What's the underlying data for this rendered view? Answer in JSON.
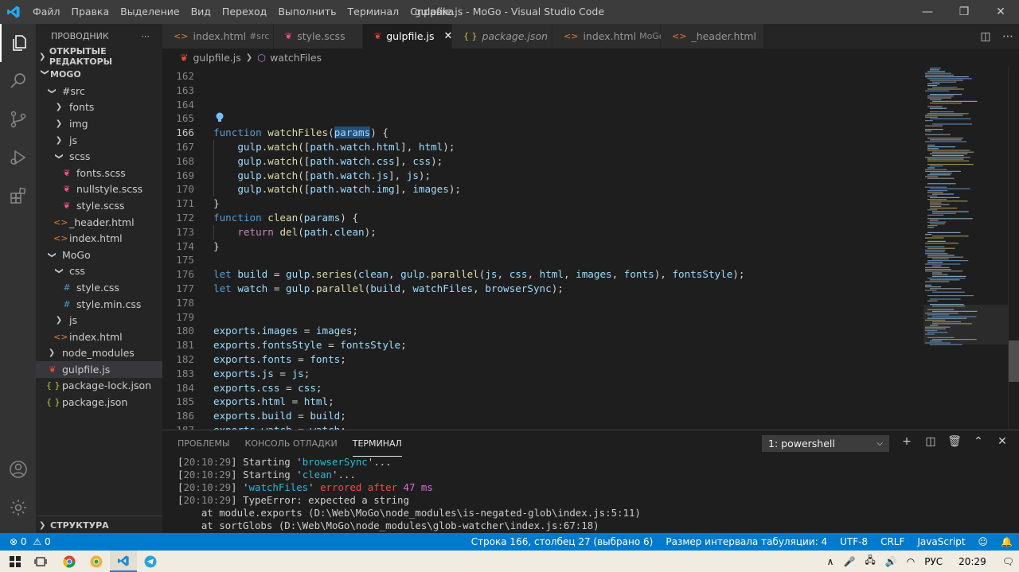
{
  "titlebar": {
    "menu": [
      "Файл",
      "Правка",
      "Выделение",
      "Вид",
      "Переход",
      "Выполнить",
      "Терминал",
      "Справка"
    ],
    "title": "gulpfile.js - MoGo - Visual Studio Code"
  },
  "sidebar": {
    "header": "ПРОВОДНИК",
    "open_editors": "ОТКРЫТЫЕ РЕДАКТОРЫ",
    "project": "MOGO",
    "items": [
      {
        "label": "#src",
        "kind": "folder-open",
        "depth": 1
      },
      {
        "label": "fonts",
        "kind": "folder",
        "depth": 2
      },
      {
        "label": "img",
        "kind": "folder",
        "depth": 2
      },
      {
        "label": "js",
        "kind": "folder",
        "depth": 2
      },
      {
        "label": "scss",
        "kind": "folder-open",
        "depth": 2
      },
      {
        "label": "fonts.scss",
        "kind": "scss",
        "depth": 3
      },
      {
        "label": "nullstyle.scss",
        "kind": "scss",
        "depth": 3
      },
      {
        "label": "style.scss",
        "kind": "scss",
        "depth": 3
      },
      {
        "label": "_header.html",
        "kind": "html",
        "depth": 2
      },
      {
        "label": "index.html",
        "kind": "html",
        "depth": 2
      },
      {
        "label": "MoGo",
        "kind": "folder-open",
        "depth": 1
      },
      {
        "label": "css",
        "kind": "folder-open",
        "depth": 2
      },
      {
        "label": "style.css",
        "kind": "css",
        "depth": 3
      },
      {
        "label": "style.min.css",
        "kind": "css",
        "depth": 3
      },
      {
        "label": "js",
        "kind": "folder",
        "depth": 2
      },
      {
        "label": "index.html",
        "kind": "html",
        "depth": 2
      },
      {
        "label": "node_modules",
        "kind": "folder",
        "depth": 1
      },
      {
        "label": "gulpfile.js",
        "kind": "gulp",
        "depth": 1,
        "selected": true
      },
      {
        "label": "package-lock.json",
        "kind": "json",
        "depth": 1
      },
      {
        "label": "package.json",
        "kind": "json",
        "depth": 1
      }
    ],
    "outline": "СТРУКТУРА"
  },
  "tabs": [
    {
      "label": "index.html",
      "desc": "#src",
      "kind": "html",
      "width": 140
    },
    {
      "label": "style.scss",
      "desc": "",
      "kind": "scss",
      "width": 112
    },
    {
      "label": "gulpfile.js",
      "desc": "",
      "kind": "gulp",
      "active": true,
      "width": 112
    },
    {
      "label": "package.json",
      "desc": "",
      "kind": "json",
      "italic": true,
      "width": 126
    },
    {
      "label": "index.html",
      "desc": "MoGo",
      "kind": "html",
      "width": 136
    },
    {
      "label": "_header.html",
      "desc": "",
      "kind": "html",
      "width": 130
    }
  ],
  "breadcrumb": {
    "file": "gulpfile.js",
    "symbol": "watchFiles"
  },
  "code_lines": [
    {
      "n": "162",
      "tokens": []
    },
    {
      "n": "163",
      "tokens": []
    },
    {
      "n": "164",
      "tokens": []
    },
    {
      "n": "165",
      "tokens": []
    },
    {
      "n": "166",
      "cur": true,
      "tokens": [
        [
          "kw",
          "function"
        ],
        [
          "plain",
          " "
        ],
        [
          "fn",
          "watchFiles"
        ],
        [
          "plain",
          "("
        ],
        [
          "hl",
          "params"
        ],
        [
          "plain",
          ") {"
        ]
      ]
    },
    {
      "n": "167",
      "tokens": [
        [
          "plain",
          "    "
        ],
        [
          "var",
          "gulp"
        ],
        [
          "plain",
          "."
        ],
        [
          "fn",
          "watch"
        ],
        [
          "plain",
          "(["
        ],
        [
          "var",
          "path"
        ],
        [
          "plain",
          "."
        ],
        [
          "var",
          "watch"
        ],
        [
          "plain",
          "."
        ],
        [
          "var",
          "html"
        ],
        [
          "plain",
          "], "
        ],
        [
          "var",
          "html"
        ],
        [
          "plain",
          ");"
        ]
      ]
    },
    {
      "n": "168",
      "tokens": [
        [
          "plain",
          "    "
        ],
        [
          "var",
          "gulp"
        ],
        [
          "plain",
          "."
        ],
        [
          "fn",
          "watch"
        ],
        [
          "plain",
          "(["
        ],
        [
          "var",
          "path"
        ],
        [
          "plain",
          "."
        ],
        [
          "var",
          "watch"
        ],
        [
          "plain",
          "."
        ],
        [
          "var",
          "css"
        ],
        [
          "plain",
          "], "
        ],
        [
          "var",
          "css"
        ],
        [
          "plain",
          ");"
        ]
      ]
    },
    {
      "n": "169",
      "tokens": [
        [
          "plain",
          "    "
        ],
        [
          "var",
          "gulp"
        ],
        [
          "plain",
          "."
        ],
        [
          "fn",
          "watch"
        ],
        [
          "plain",
          "(["
        ],
        [
          "var",
          "path"
        ],
        [
          "plain",
          "."
        ],
        [
          "var",
          "watch"
        ],
        [
          "plain",
          "."
        ],
        [
          "var",
          "js"
        ],
        [
          "plain",
          "], "
        ],
        [
          "var",
          "js"
        ],
        [
          "plain",
          ");"
        ]
      ]
    },
    {
      "n": "170",
      "tokens": [
        [
          "plain",
          "    "
        ],
        [
          "var",
          "gulp"
        ],
        [
          "plain",
          "."
        ],
        [
          "fn",
          "watch"
        ],
        [
          "plain",
          "(["
        ],
        [
          "var",
          "path"
        ],
        [
          "plain",
          "."
        ],
        [
          "var",
          "watch"
        ],
        [
          "plain",
          "."
        ],
        [
          "var",
          "img"
        ],
        [
          "plain",
          "], "
        ],
        [
          "var",
          "images"
        ],
        [
          "plain",
          ");"
        ]
      ]
    },
    {
      "n": "171",
      "tokens": [
        [
          "plain",
          "}"
        ]
      ]
    },
    {
      "n": "172",
      "tokens": [
        [
          "kw",
          "function"
        ],
        [
          "plain",
          " "
        ],
        [
          "fn",
          "clean"
        ],
        [
          "plain",
          "("
        ],
        [
          "var",
          "params"
        ],
        [
          "plain",
          ") {"
        ]
      ]
    },
    {
      "n": "173",
      "tokens": [
        [
          "plain",
          "    "
        ],
        [
          "ctl",
          "return"
        ],
        [
          "plain",
          " "
        ],
        [
          "fn",
          "del"
        ],
        [
          "plain",
          "("
        ],
        [
          "var",
          "path"
        ],
        [
          "plain",
          "."
        ],
        [
          "var",
          "clean"
        ],
        [
          "plain",
          ");"
        ]
      ]
    },
    {
      "n": "174",
      "tokens": [
        [
          "plain",
          "}"
        ]
      ]
    },
    {
      "n": "175",
      "tokens": []
    },
    {
      "n": "176",
      "tokens": [
        [
          "kw",
          "let"
        ],
        [
          "plain",
          " "
        ],
        [
          "var",
          "build"
        ],
        [
          "plain",
          " = "
        ],
        [
          "var",
          "gulp"
        ],
        [
          "plain",
          "."
        ],
        [
          "fn",
          "series"
        ],
        [
          "plain",
          "("
        ],
        [
          "var",
          "clean"
        ],
        [
          "plain",
          ", "
        ],
        [
          "var",
          "gulp"
        ],
        [
          "plain",
          "."
        ],
        [
          "fn",
          "parallel"
        ],
        [
          "plain",
          "("
        ],
        [
          "var",
          "js"
        ],
        [
          "plain",
          ", "
        ],
        [
          "var",
          "css"
        ],
        [
          "plain",
          ", "
        ],
        [
          "var",
          "html"
        ],
        [
          "plain",
          ", "
        ],
        [
          "var",
          "images"
        ],
        [
          "plain",
          ", "
        ],
        [
          "var",
          "fonts"
        ],
        [
          "plain",
          "), "
        ],
        [
          "var",
          "fontsStyle"
        ],
        [
          "plain",
          ");"
        ]
      ]
    },
    {
      "n": "177",
      "tokens": [
        [
          "kw",
          "let"
        ],
        [
          "plain",
          " "
        ],
        [
          "var",
          "watch"
        ],
        [
          "plain",
          " = "
        ],
        [
          "var",
          "gulp"
        ],
        [
          "plain",
          "."
        ],
        [
          "fn",
          "parallel"
        ],
        [
          "plain",
          "("
        ],
        [
          "var",
          "build"
        ],
        [
          "plain",
          ", "
        ],
        [
          "var",
          "watchFiles"
        ],
        [
          "plain",
          ", "
        ],
        [
          "var",
          "browserSync"
        ],
        [
          "plain",
          ");"
        ]
      ]
    },
    {
      "n": "178",
      "tokens": []
    },
    {
      "n": "179",
      "tokens": []
    },
    {
      "n": "180",
      "tokens": [
        [
          "var",
          "exports"
        ],
        [
          "plain",
          "."
        ],
        [
          "var",
          "images"
        ],
        [
          "plain",
          " = "
        ],
        [
          "var",
          "images"
        ],
        [
          "plain",
          ";"
        ]
      ]
    },
    {
      "n": "181",
      "tokens": [
        [
          "var",
          "exports"
        ],
        [
          "plain",
          "."
        ],
        [
          "var",
          "fontsStyle"
        ],
        [
          "plain",
          " = "
        ],
        [
          "var",
          "fontsStyle"
        ],
        [
          "plain",
          ";"
        ]
      ]
    },
    {
      "n": "182",
      "tokens": [
        [
          "var",
          "exports"
        ],
        [
          "plain",
          "."
        ],
        [
          "var",
          "fonts"
        ],
        [
          "plain",
          " = "
        ],
        [
          "var",
          "fonts"
        ],
        [
          "plain",
          ";"
        ]
      ]
    },
    {
      "n": "183",
      "tokens": [
        [
          "var",
          "exports"
        ],
        [
          "plain",
          "."
        ],
        [
          "var",
          "js"
        ],
        [
          "plain",
          " = "
        ],
        [
          "var",
          "js"
        ],
        [
          "plain",
          ";"
        ]
      ]
    },
    {
      "n": "184",
      "tokens": [
        [
          "var",
          "exports"
        ],
        [
          "plain",
          "."
        ],
        [
          "var",
          "css"
        ],
        [
          "plain",
          " = "
        ],
        [
          "var",
          "css"
        ],
        [
          "plain",
          ";"
        ]
      ]
    },
    {
      "n": "185",
      "tokens": [
        [
          "var",
          "exports"
        ],
        [
          "plain",
          "."
        ],
        [
          "var",
          "html"
        ],
        [
          "plain",
          " = "
        ],
        [
          "var",
          "html"
        ],
        [
          "plain",
          ";"
        ]
      ]
    },
    {
      "n": "186",
      "tokens": [
        [
          "var",
          "exports"
        ],
        [
          "plain",
          "."
        ],
        [
          "var",
          "build"
        ],
        [
          "plain",
          " = "
        ],
        [
          "var",
          "build"
        ],
        [
          "plain",
          ";"
        ]
      ]
    },
    {
      "n": "187",
      "tokens": [
        [
          "var",
          "exports"
        ],
        [
          "plain",
          "."
        ],
        [
          "var",
          "watch"
        ],
        [
          "plain",
          " = "
        ],
        [
          "var",
          "watch"
        ],
        [
          "plain",
          ";"
        ]
      ]
    }
  ],
  "panel": {
    "tabs": [
      "ПРОБЛЕМЫ",
      "КОНСОЛЬ ОТЛАДКИ",
      "ТЕРМИНАЛ"
    ],
    "active_tab": 2,
    "terminal_select": "1: powershell",
    "terminal_lines": [
      [
        [
          "plain",
          "["
        ],
        [
          "dim",
          "20:10:29"
        ],
        [
          "plain",
          "] Starting '"
        ],
        [
          "cyan",
          "browserSync"
        ],
        [
          "plain",
          "'..."
        ]
      ],
      [
        [
          "plain",
          "["
        ],
        [
          "dim",
          "20:10:29"
        ],
        [
          "plain",
          "] Starting '"
        ],
        [
          "cyan",
          "clean"
        ],
        [
          "plain",
          "'..."
        ]
      ],
      [
        [
          "plain",
          "["
        ],
        [
          "dim",
          "20:10:29"
        ],
        [
          "plain",
          "] '"
        ],
        [
          "cyan",
          "watchFiles"
        ],
        [
          "plain",
          "' "
        ],
        [
          "red",
          "errored after"
        ],
        [
          "plain",
          " "
        ],
        [
          "mag",
          "47 ms"
        ]
      ],
      [
        [
          "plain",
          "["
        ],
        [
          "dim",
          "20:10:29"
        ],
        [
          "plain",
          "] TypeError: expected a string"
        ]
      ],
      [
        [
          "plain",
          "    at module.exports (D:\\Web\\MoGo\\node_modules\\is-negated-glob\\index.js:5:11)"
        ]
      ],
      [
        [
          "plain",
          "    at sortGlobs (D:\\Web\\MoGo\\node_modules\\glob-watcher\\index.js:67:18)"
        ]
      ]
    ]
  },
  "statusbar": {
    "problems": "0",
    "warnings": "0",
    "position": "Строка 166, столбец 27 (выбрано 6)",
    "indent": "Размер интервала табуляции: 4",
    "encoding": "UTF-8",
    "eol": "CRLF",
    "language": "JavaScript"
  },
  "taskbar": {
    "lang": "РУС",
    "time": "20:29"
  },
  "colors": {
    "accent": "#007acc",
    "editor_bg": "#1e1e1e",
    "sidebar_bg": "#252526",
    "activity_bg": "#333333",
    "titlebar_bg": "#3c3c3c"
  }
}
